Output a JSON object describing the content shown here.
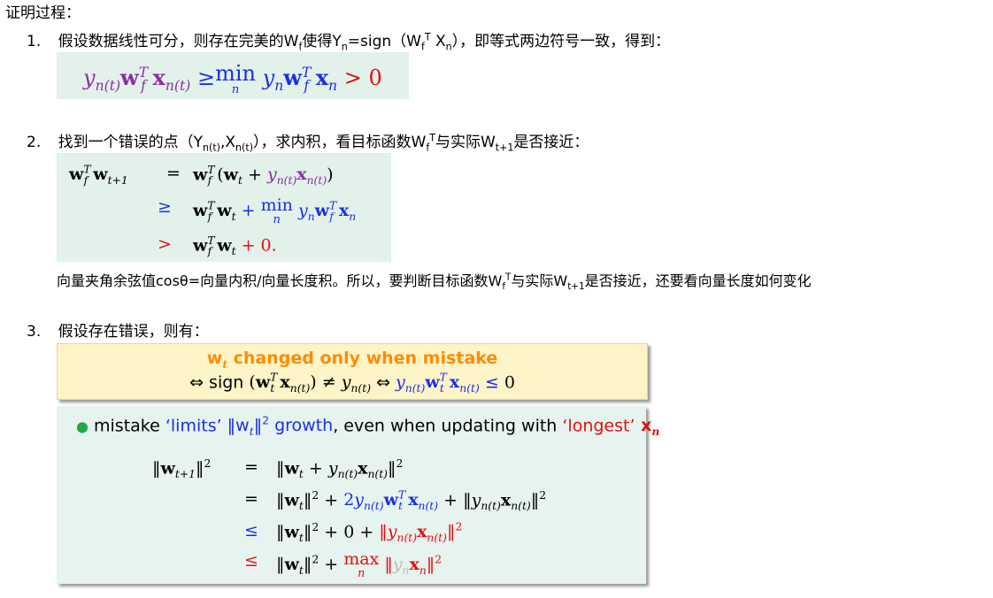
{
  "heading": "证明过程：",
  "items": [
    {
      "num": "1.",
      "text": "假设数据线性可分，则存在完美的W",
      "text_sub": "f",
      "text2": "使得Y",
      "text2_sub": "n",
      "text3": "=sign（W",
      "text3_sub": "f",
      "text3_sup": "T",
      "text4": " X",
      "text4_sub": "n",
      "text5": "），即等式两边符号一致，得到："
    },
    {
      "num": "2.",
      "text": "找到一个错误的点（Y",
      "text_sub": "n(t)",
      "text2": ",X",
      "text2_sub": "n(t)",
      "text3": "），求内积，看目标函数W",
      "text3_sub": "f",
      "text3_sup": "T",
      "text4": "与实际W",
      "text4_sub": "t+1",
      "text5": "是否接近："
    },
    {
      "num": "3.",
      "text": "假设存在错误，则有："
    }
  ],
  "note": {
    "text": "向量夹角余弦值cosθ=向量内积/向量长度积。所以，要判断目标函数W",
    "sub": "f",
    "sup": "T",
    "text2": "与实际W",
    "sub2": "t+1",
    "text3": "是否接近，还要看向量长度如何变化"
  },
  "yellow": {
    "line1_w": "w",
    "line1_t": "t",
    "line1_rest": " changed only when mistake",
    "line2_prefix": "⇔ sign"
  },
  "green": {
    "bullet_a": "mistake ",
    "bullet_b": "‘limits’",
    "bullet_c": " ‖w",
    "bullet_d": "‖",
    "bullet_e": " growth",
    "bullet_f": ", even when updating with ",
    "bullet_g": "‘longest’",
    "bullet_h": " x"
  },
  "ops": {
    "eq": "=",
    "ge": "≥",
    "gt": ">",
    "le": "≤",
    "zero": "0",
    "min": "min",
    "max": "max",
    "n": "n",
    "plus0": "+ 0.",
    "gt0": "> 0"
  }
}
